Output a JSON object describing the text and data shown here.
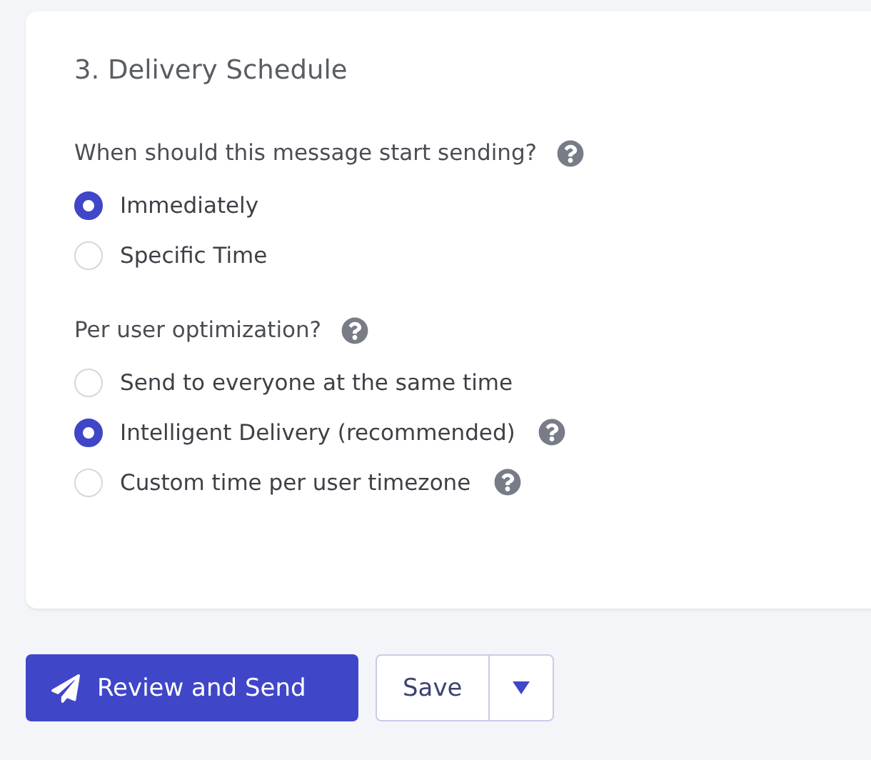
{
  "section": {
    "title": "3. Delivery Schedule",
    "groups": [
      {
        "question": "When should this message start sending?",
        "help": true,
        "options": [
          {
            "label": "Immediately",
            "selected": true,
            "help": false
          },
          {
            "label": "Specific Time",
            "selected": false,
            "help": false
          }
        ]
      },
      {
        "question": "Per user optimization?",
        "help": true,
        "options": [
          {
            "label": "Send to everyone at the same time",
            "selected": false,
            "help": false
          },
          {
            "label": "Intelligent Delivery (recommended)",
            "selected": true,
            "help": true
          },
          {
            "label": "Custom time per user timezone",
            "selected": false,
            "help": true
          }
        ]
      }
    ]
  },
  "actions": {
    "primary": "Review and Send",
    "secondary": "Save"
  }
}
